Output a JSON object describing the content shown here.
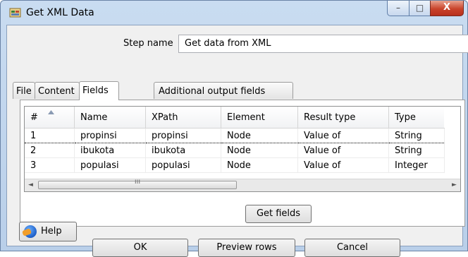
{
  "window": {
    "title": "Get XML Data",
    "minimize": "–",
    "maximize": "□",
    "close": "X"
  },
  "step": {
    "label": "Step name",
    "value": "Get data from XML"
  },
  "tabs": [
    {
      "label": "File",
      "active": false
    },
    {
      "label": "Content",
      "active": false
    },
    {
      "label": "Fields",
      "active": true
    },
    {
      "label": "Additional output fields",
      "active": false
    }
  ],
  "grid": {
    "columns": [
      "#",
      "Name",
      "XPath",
      "Element",
      "Result type",
      "Type"
    ],
    "rows": [
      [
        "1",
        "propinsi",
        "propinsi",
        "Node",
        "Value of",
        "String"
      ],
      [
        "2",
        "ibukota",
        "ibukota",
        "Node",
        "Value of",
        "String"
      ],
      [
        "3",
        "populasi",
        "populasi",
        "Node",
        "Value of",
        "Integer"
      ]
    ],
    "scroll_left": "◄",
    "scroll_right": "►",
    "scroll_grip": "ııı"
  },
  "buttons": {
    "get_fields": "Get fields",
    "ok": "OK",
    "preview": "Preview rows",
    "cancel": "Cancel",
    "help": "Help"
  },
  "colors": {
    "window_frame": "#c9dcf1",
    "close_button": "#c9432b"
  },
  "icons": [
    "app-icon",
    "help-icon",
    "sort-arrow-icon"
  ]
}
